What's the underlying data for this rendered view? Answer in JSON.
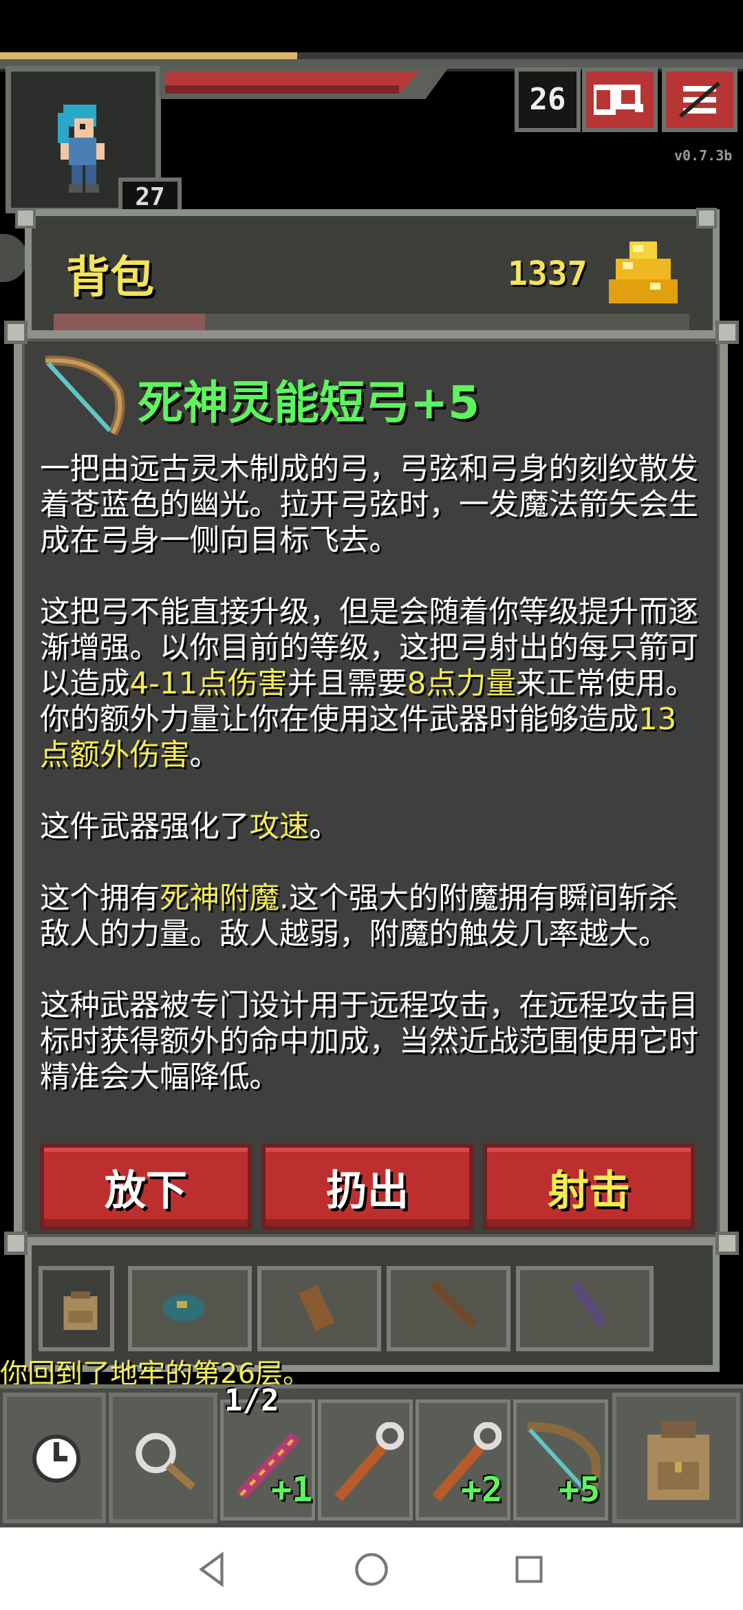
{
  "hud": {
    "xp_fraction": 0.4,
    "hp_fraction": 0.88,
    "hero_level": "27",
    "depth": "26",
    "version": "v0.7.3b",
    "icons": {
      "journal": "search-journal-icon",
      "menu": "menu-icon"
    }
  },
  "backpack": {
    "title": "背包",
    "gold": "1337",
    "gold_icon": "gold-pile-icon"
  },
  "item": {
    "icon": "bow-icon",
    "title": "死神灵能短弓+5",
    "desc": {
      "p1": "一把由远古灵木制成的弓，弓弦和弓身的刻纹散发着苍蓝色的幽光。拉开弓弦时，一发魔法箭矢会生成在弓身一侧向目标飞去。",
      "p2_a": "这把弓不能直接升级，但是会随着你等级提升而逐渐增强。以你目前的等级，这把弓射出的每只箭可以造成",
      "p2_hl1": "4-11点伤害",
      "p2_b": "并且需要",
      "p2_hl2": "8点力量",
      "p2_c": "来正常使用。你的额外力量让你在使用这件武器时能够造成",
      "p2_hl3": "13点额外伤害",
      "p2_d": "。",
      "p3_a": "这件武器强化了",
      "p3_hl": "攻速",
      "p3_b": "。",
      "p4_a": "这个拥有",
      "p4_hl": "死神附魔",
      "p4_b": ".这个强大的附魔拥有瞬间斩杀敌人的力量。敌人越弱，附魔的触发几率越大。",
      "p5": "这种武器被专门设计用于远程攻击，在远程攻击目标时获得额外的命中加成，当然近战范围使用它时精准会大幅降低。"
    },
    "actions": {
      "drop": "放下",
      "throw": "扔出",
      "shoot": "射击"
    }
  },
  "log": {
    "message": "你回到了地牢的第26层。"
  },
  "toolbar": {
    "wait_icon": "clock-icon",
    "search_icon": "magnifier-icon",
    "quickslots": [
      {
        "icon": "wand-icon",
        "count": "1/2",
        "bonus": "+1"
      },
      {
        "icon": "staff-icon",
        "bonus": ""
      },
      {
        "icon": "staff-icon",
        "bonus": "+2"
      },
      {
        "icon": "bow-icon",
        "bonus": "+5"
      }
    ],
    "backpack_icon": "backpack-icon"
  },
  "colors": {
    "item_title": "#5cf55c",
    "highlight": "#f5ec54",
    "action_button": "#bd2f2f",
    "panel_bg": "#3f403d"
  }
}
